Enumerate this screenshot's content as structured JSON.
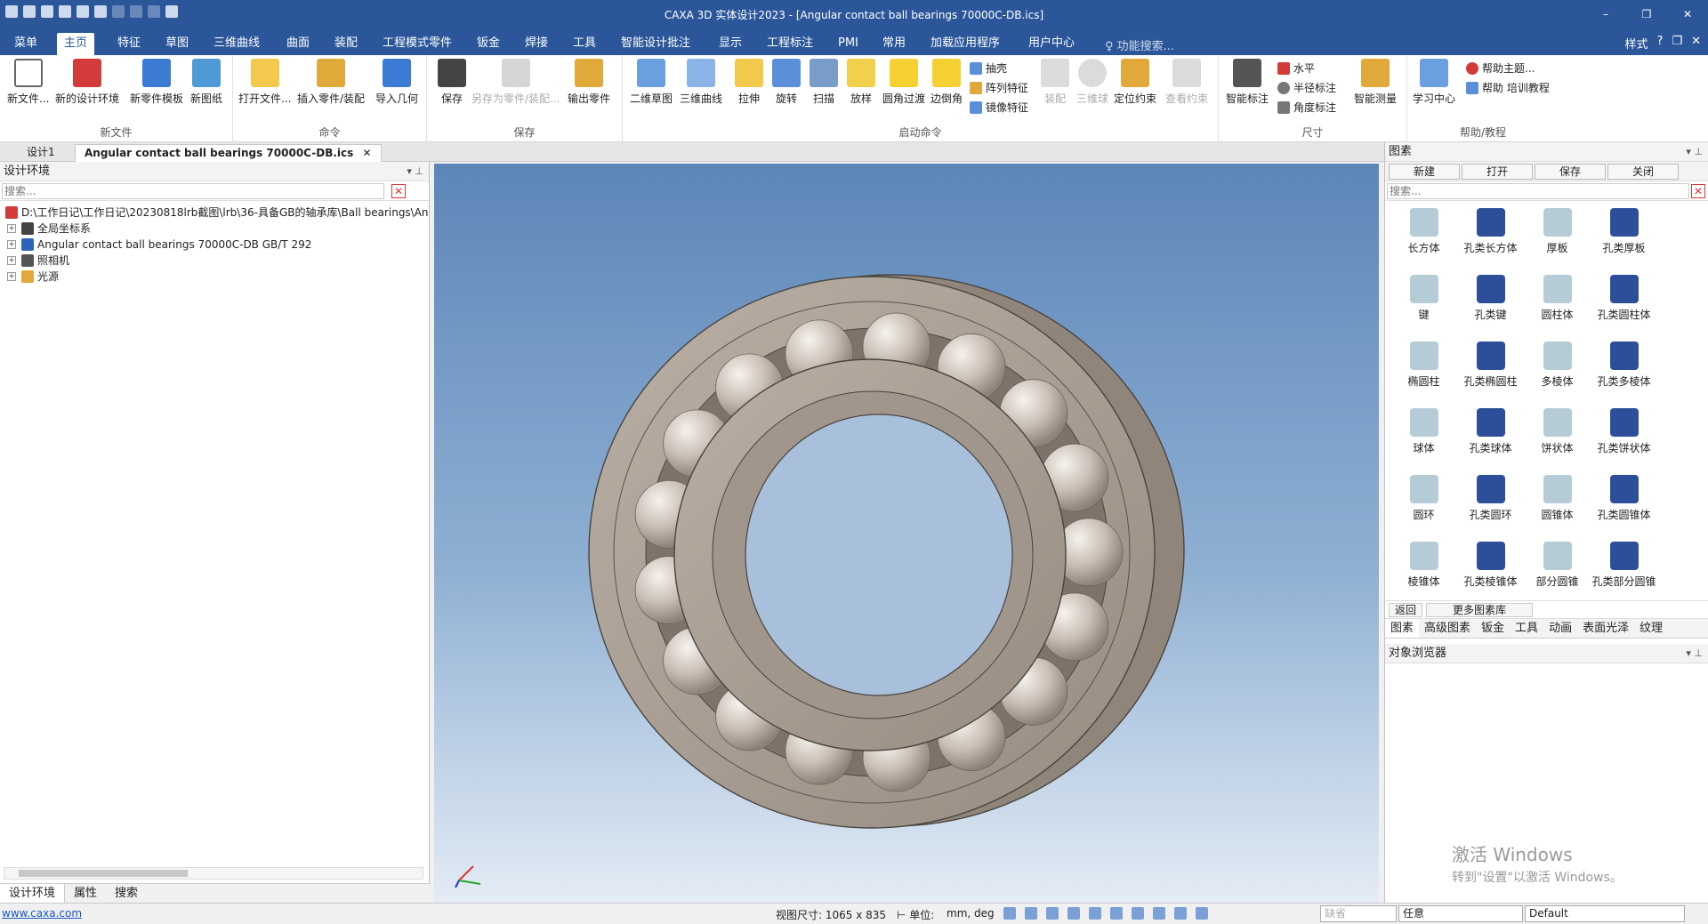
{
  "window": {
    "title": "CAXA 3D 实体设计2023 - [Angular contact ball bearings 70000C-DB.ics]",
    "controls": [
      "–",
      "❐",
      "✕"
    ]
  },
  "menu": {
    "tabs": [
      "菜单",
      "主页",
      "特征",
      "草图",
      "三维曲线",
      "曲面",
      "装配",
      "工程模式零件",
      "钣金",
      "焊接",
      "工具",
      "智能设计批注",
      "显示",
      "工程标注",
      "PMI",
      "常用",
      "加载应用程序",
      "用户中心"
    ],
    "active": "主页",
    "search_placeholder": "功能搜索...",
    "style_label": "样式",
    "help_symbol": "?"
  },
  "ribbon": {
    "groups": [
      {
        "label": "新文件",
        "buttons": [
          "新文件...",
          "新的设计环境",
          "新零件模板",
          "新图纸"
        ]
      },
      {
        "label": "命令",
        "buttons": [
          "打开文件...",
          "插入零件/装配",
          "导入几何"
        ]
      },
      {
        "label": "保存",
        "buttons": [
          "保存",
          "另存为零件/装配...",
          "输出零件"
        ]
      },
      {
        "label": "启动命令",
        "buttons": [
          "二维草图",
          "三维曲线",
          "拉伸",
          "旋转",
          "扫描",
          "放样",
          "圆角过渡",
          "边倒角",
          "装配",
          "三维球",
          "定位约束",
          "查看约束"
        ],
        "small": [
          "抽壳",
          "阵列特征",
          "镜像特征"
        ]
      },
      {
        "label": "尺寸",
        "buttons": [
          "智能标注",
          "智能测量"
        ],
        "small": [
          "水平",
          "半径标注",
          "角度标注"
        ]
      },
      {
        "label": "帮助/教程",
        "buttons": [
          "学习中心"
        ],
        "small": [
          "帮助主题...",
          "帮助 培训教程"
        ]
      }
    ]
  },
  "doc_tabs": [
    "设计1",
    "Angular contact ball bearings 70000C-DB.ics"
  ],
  "left_panel": {
    "title": "设计环境",
    "search_placeholder": "搜索...",
    "tree": [
      "D:\\工作日记\\工作日记\\20230818lrb截图\\lrb\\36-具备GB的轴承库\\Ball bearings\\An",
      "全局坐标系",
      "Angular contact ball bearings 70000C-DB GB/T 292",
      "照相机",
      "光源"
    ],
    "tabs": [
      "设计环境",
      "属性",
      "搜索"
    ]
  },
  "right_panel": {
    "title": "图素",
    "toolbar": [
      "新建",
      "打开",
      "保存",
      "关闭"
    ],
    "search_placeholder": "搜索...",
    "items": [
      "长方体",
      "孔类长方体",
      "厚板",
      "孔类厚板",
      "键",
      "孔类键",
      "圆柱体",
      "孔类圆柱体",
      "椭圆柱",
      "孔类椭圆柱",
      "多棱体",
      "孔类多棱体",
      "球体",
      "孔类球体",
      "饼状体",
      "孔类饼状体",
      "圆环",
      "孔类圆环",
      "圆锥体",
      "孔类圆锥体",
      "棱锥体",
      "孔类棱锥体",
      "部分圆锥",
      "孔类部分圆锥"
    ],
    "footer": [
      "返回",
      "更多图素库"
    ],
    "tabs": [
      "图素",
      "高级图素",
      "钣金",
      "工具",
      "动画",
      "表面光泽",
      "纹理"
    ],
    "object_browser_title": "对象浏览器"
  },
  "watermark": {
    "line1": "激活 Windows",
    "line2": "转到\"设置\"以激活 Windows。"
  },
  "status": {
    "link": "www.caxa.com",
    "view_size": "视图尺寸: 1065 x  835",
    "unit_label": "单位:",
    "unit_value": "mm, deg",
    "filter_placeholder": "缺省",
    "select_mode": "任意",
    "default_value": "Default"
  },
  "colors": {
    "title_bg": "#2b579a",
    "bearing": "#a79d92",
    "ball": "#cfc6bd"
  }
}
